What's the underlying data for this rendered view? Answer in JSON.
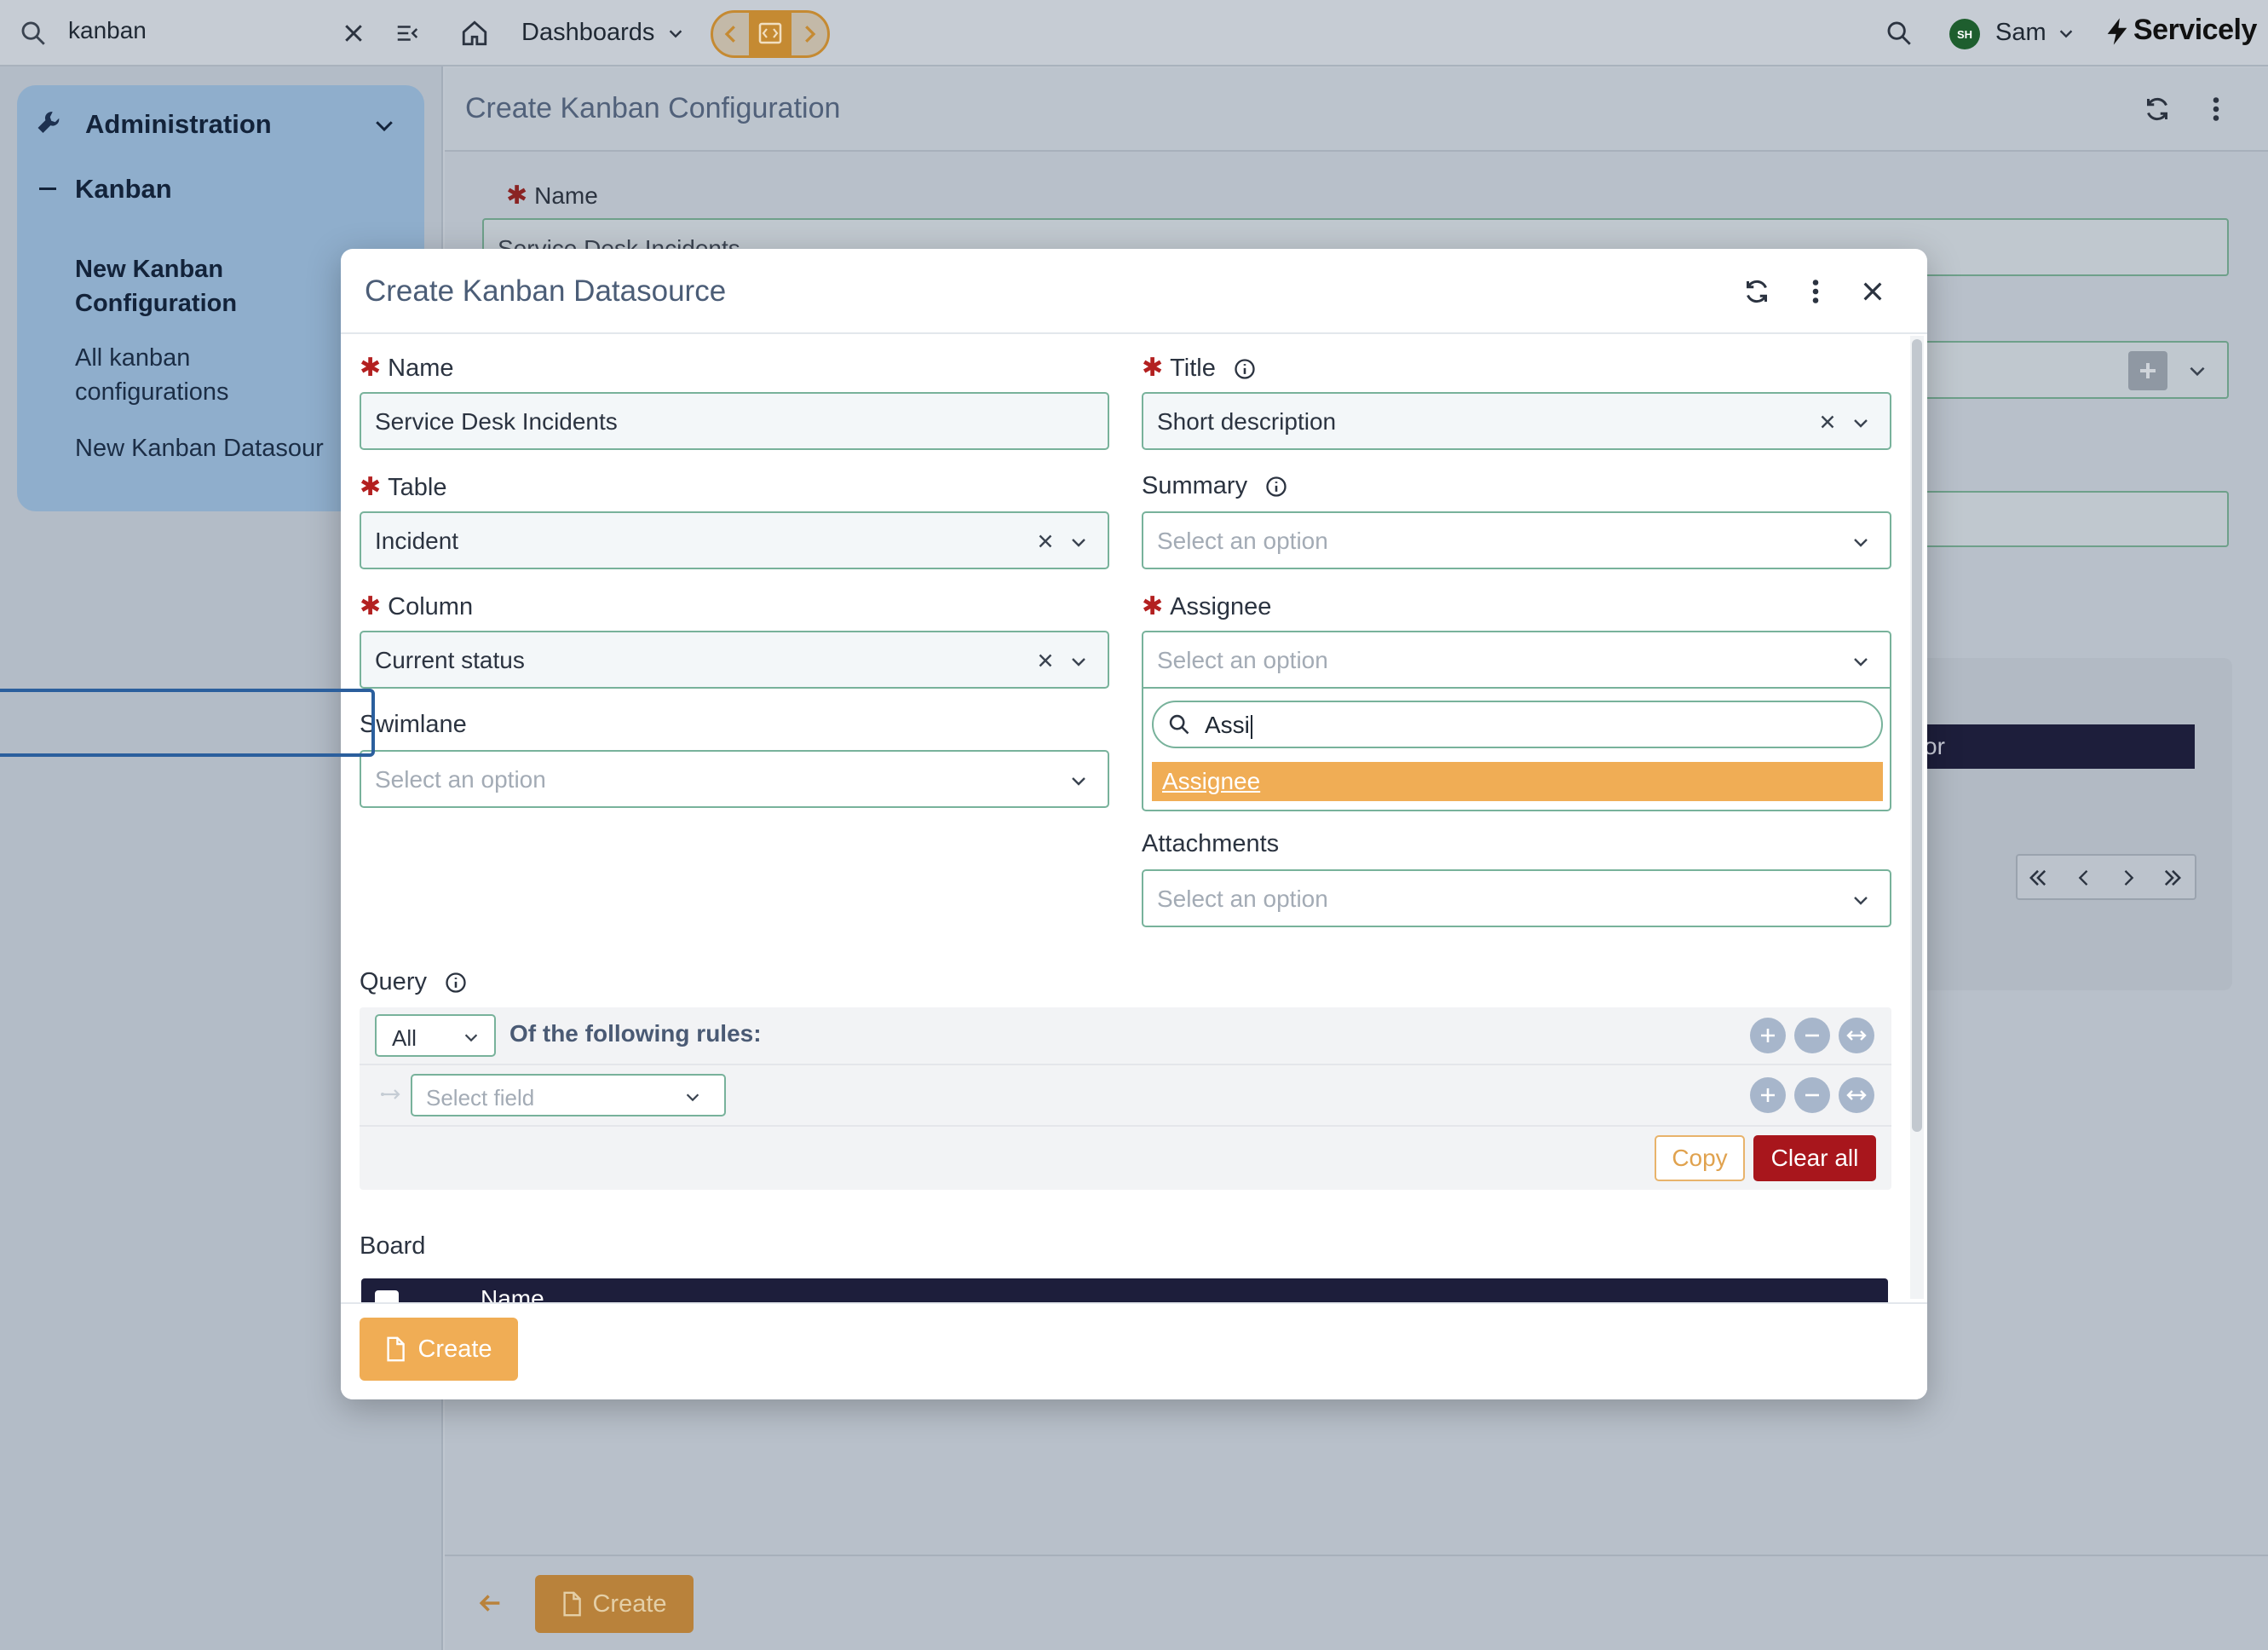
{
  "nav": {
    "search_value": "kanban",
    "section_title": "Administration",
    "subsection_title": "Kanban",
    "items": [
      {
        "label_line1": "New Kanban",
        "label_line2": "Configuration"
      },
      {
        "label_line1": "All kanban",
        "label_line2": "configurations"
      },
      {
        "label_line1": "New Kanban Datasour",
        "label_line2": ""
      }
    ]
  },
  "topbar": {
    "dashboards_label": "Dashboards",
    "user_initials": "SH",
    "user_name": "Sam",
    "brand": "Servicely"
  },
  "page": {
    "title": "Create Kanban Configuration",
    "name_label": "Name",
    "name_value": "Service Desk Incidents",
    "footer_create_label": "Create"
  },
  "background_table": {
    "header_fragment": "or"
  },
  "modal": {
    "title": "Create Kanban Datasource",
    "fields": {
      "name": {
        "label": "Name",
        "value": "Service Desk Incidents"
      },
      "title": {
        "label": "Title",
        "value": "Short description"
      },
      "table": {
        "label": "Table",
        "value": "Incident"
      },
      "summary": {
        "label": "Summary",
        "placeholder": "Select an option"
      },
      "column": {
        "label": "Column",
        "value": "Current status"
      },
      "assignee": {
        "label": "Assignee",
        "placeholder": "Select an option"
      },
      "swimlane": {
        "label": "Swimlane",
        "placeholder": "Select an option"
      },
      "attachments": {
        "label": "Attachments",
        "placeholder": "Select an option"
      }
    },
    "assignee_dropdown": {
      "search_value": "Assi",
      "options": [
        "Assignee"
      ]
    },
    "query": {
      "label": "Query",
      "match_value": "All",
      "rules_label": "Of the following rules:",
      "field_placeholder": "Select field",
      "copy_label": "Copy",
      "clear_label": "Clear all"
    },
    "board": {
      "label": "Board",
      "name_header": "Name"
    },
    "create_label": "Create"
  },
  "colors": {
    "accent_orange": "#f0ad55",
    "danger_red": "#a8161c",
    "field_border": "#78b29b",
    "navy": "#1d1e3b"
  }
}
